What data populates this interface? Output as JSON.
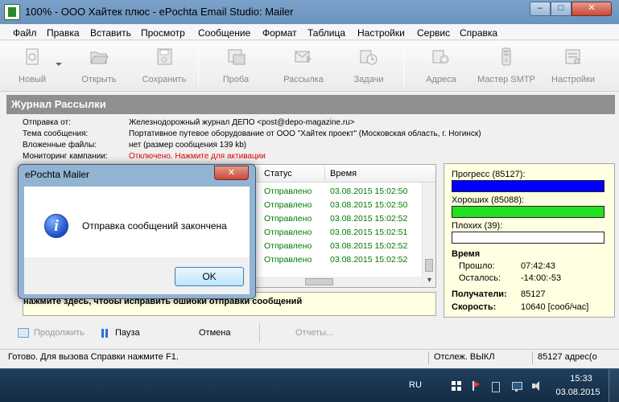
{
  "window": {
    "title": "100% - ООО Хайтек плюс - ePochta Email Studio: Mailer",
    "minimize": "–",
    "maximize": "□",
    "close": "✕"
  },
  "menu": [
    "Файл",
    "Правка",
    "Вставить",
    "Просмотр",
    "Сообщение",
    "Формат",
    "Таблица",
    "Настройки",
    "Сервис",
    "Справка"
  ],
  "toolbar": {
    "new": "Новый",
    "open": "Открыть",
    "save": "Сохранить",
    "test": "Проба",
    "mailing": "Рассылка",
    "tasks": "Задачи",
    "addresses": "Адреса",
    "smtp_wizard": "Мастер SMTP",
    "settings": "Настройки"
  },
  "journal": {
    "title": "Журнал Рассылки",
    "from_label": "Отправка от:",
    "from_value": "Железнодорожный журнал ДЕПО <post@depo-magazine.ru>",
    "subject_label": "Тема сообщения:",
    "subject_value": "Портативное путевое оборудование от ООО \"Хайтек проект\" (Московская область, г. Ногинск)",
    "attachments_label": "Вложенные файлы:",
    "attachments_value": "нет    (размер сообщения 139 kb)",
    "monitoring_label": "Мониторинг кампании:",
    "monitoring_value": "Отключено. Нажмите для активации"
  },
  "list": {
    "col_status": "Статус",
    "col_time": "Время",
    "rows": [
      {
        "status": "Отправлено",
        "time": "03.08.2015 15:02:50"
      },
      {
        "status": "Отправлено",
        "time": "03.08.2015 15:02:50"
      },
      {
        "status": "Отправлено",
        "time": "03.08.2015 15:02:52"
      },
      {
        "status": "Отправлено",
        "time": "03.08.2015 15:02:51"
      },
      {
        "status": "Отправлено",
        "time": "03.08.2015 15:02:52"
      },
      {
        "status": "Отправлено",
        "time": "03.08.2015 15:02:52"
      }
    ]
  },
  "notice": "нажмите здесь, чтобы исправить ошибки отправки сообщений",
  "stats": {
    "progress_label": "Прогресс (85127):",
    "progress_fraction": 1.0,
    "good_label": "Хороших (85088):",
    "good_fraction": 1.0,
    "bad_label": "Плохих (39):",
    "bad_fraction": 0.0,
    "time_header": "Время",
    "elapsed_label": "Прошло:",
    "elapsed_value": "07:42:43",
    "remaining_label": "Осталось:",
    "remaining_value": "-14:00:-53",
    "recipients_label": "Получатели:",
    "recipients_value": "85127",
    "speed_label": "Скорость:",
    "speed_value": "10640 [сооб/час]",
    "progress_color": "#0000ff",
    "good_color": "#22e022"
  },
  "actions": {
    "continue": "Продолжить",
    "pause": "Пауза",
    "cancel": "Отмена",
    "reports": "Отчеты..."
  },
  "statusbar": {
    "ready": "Готово. Для вызова Справки нажмите F1.",
    "tracking": "Отслеж. ВЫКЛ",
    "addresses": "85127 адрес(о"
  },
  "dialog": {
    "title": "ePochta Mailer",
    "close": "✕",
    "icon_glyph": "i",
    "message": "Отправка сообщений закончена",
    "ok": "OK"
  },
  "taskbar": {
    "lang": "RU",
    "time": "15:33",
    "date": "03.08.2015"
  }
}
